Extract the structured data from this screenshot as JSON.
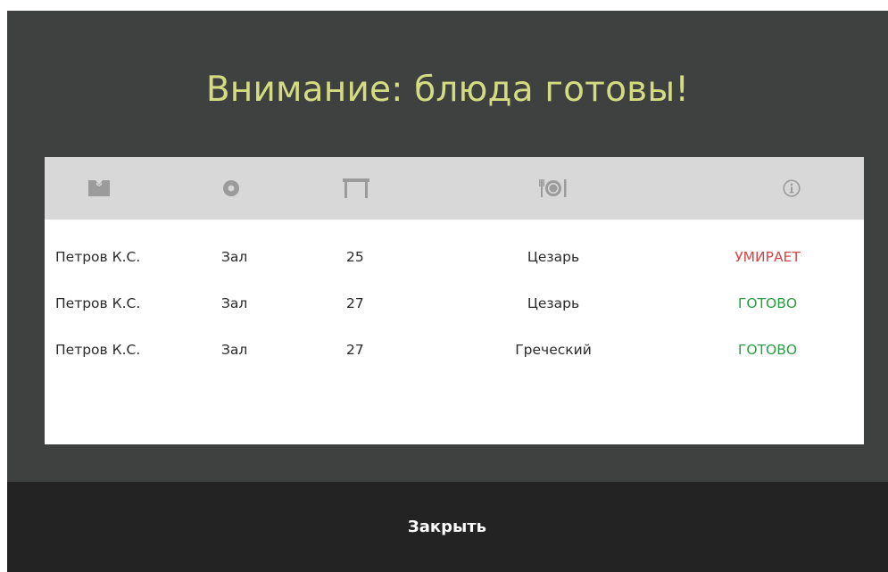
{
  "modal": {
    "title": "Внимание: блюда готовы!",
    "title_color": "#d4dc82",
    "background": "#3f4140",
    "footer_background": "#232323"
  },
  "table": {
    "header_icons": [
      "waiter-icon",
      "zone-icon",
      "table-icon",
      "dish-icon",
      "info-icon"
    ],
    "header_background": "#d8d8d8",
    "icon_color": "#9b9b9b",
    "rows": [
      {
        "waiter": "Петров К.С.",
        "zone": "Зал",
        "table": "25",
        "dish": "Цезарь",
        "status": "УМИРАЕТ",
        "status_color": "#d64545"
      },
      {
        "waiter": "Петров К.С.",
        "zone": "Зал",
        "table": "27",
        "dish": "Цезарь",
        "status": "ГОТОВО",
        "status_color": "#2e9b45"
      },
      {
        "waiter": "Петров К.С.",
        "zone": "Зал",
        "table": "27",
        "dish": "Греческий",
        "status": "ГОТОВО",
        "status_color": "#2e9b45"
      }
    ]
  },
  "footer": {
    "close_label": "Закрыть"
  }
}
